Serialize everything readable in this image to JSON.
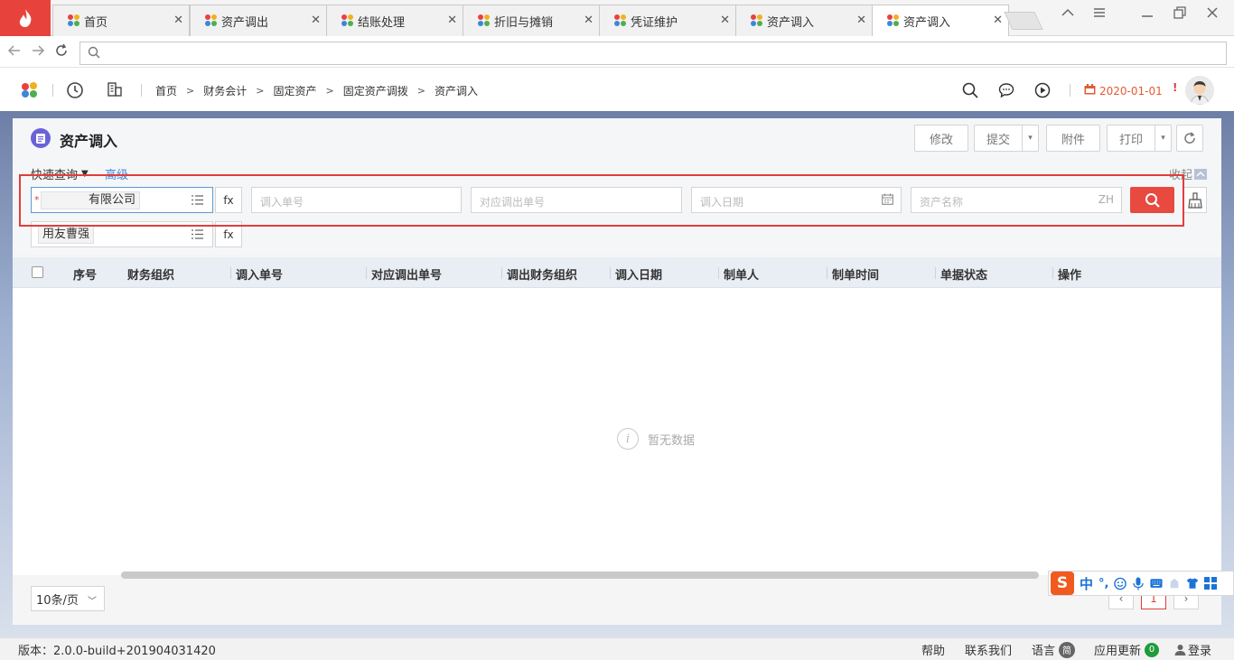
{
  "browser": {
    "tabs": [
      {
        "label": "首页"
      },
      {
        "label": "资产调出"
      },
      {
        "label": "结账处理"
      },
      {
        "label": "折旧与摊销"
      },
      {
        "label": "凭证维护"
      },
      {
        "label": "资产调入"
      },
      {
        "label": "资产调入"
      }
    ],
    "close_glyph": "✕",
    "address_value": ""
  },
  "header": {
    "breadcrumb": [
      "首页",
      "财务会计",
      "固定资产",
      "固定资产调拨",
      "资产调入"
    ],
    "date": "2020-01-01",
    "alert_mark": "!"
  },
  "page": {
    "title": "资产调入",
    "toolbar": {
      "modify": "修改",
      "submit": "提交",
      "attachment": "附件",
      "print": "打印"
    },
    "filters": {
      "quick_query": "快速查询",
      "advanced": "高级",
      "collapse": "收起",
      "org_required_mark": "*",
      "org_value": "有限公司",
      "fx_label": "fx",
      "transfer_in_no_placeholder": "调入单号",
      "transfer_out_no_placeholder": "对应调出单号",
      "transfer_in_date_placeholder": "调入日期",
      "asset_name_placeholder": "资产名称",
      "asset_name_suffix": "ZH",
      "maker_value": "用友曹强"
    },
    "table": {
      "columns": [
        "序号",
        "财务组织",
        "调入单号",
        "对应调出单号",
        "调出财务组织",
        "调入日期",
        "制单人",
        "制单时间",
        "单据状态",
        "操作"
      ],
      "rows": [],
      "empty_text": "暂无数据",
      "empty_icon_glyph": "i"
    },
    "pagination": {
      "page_size": "10条/页",
      "prev": "‹",
      "current": "1",
      "next": "›"
    }
  },
  "ime": {
    "logo": "S",
    "mode": "中",
    "punct": "°,"
  },
  "footer": {
    "version": "版本：2.0.0-build+201904031420",
    "help": "帮助",
    "contact": "联系我们",
    "language": "语言",
    "language_badge": "简",
    "updates": "应用更新",
    "updates_count": "0",
    "login": "登录"
  },
  "colors": {
    "brand_red": "#e8423d",
    "accent_blue": "#3d86d8",
    "date_orange": "#e25c32",
    "title_icon": "#6a62d8"
  }
}
